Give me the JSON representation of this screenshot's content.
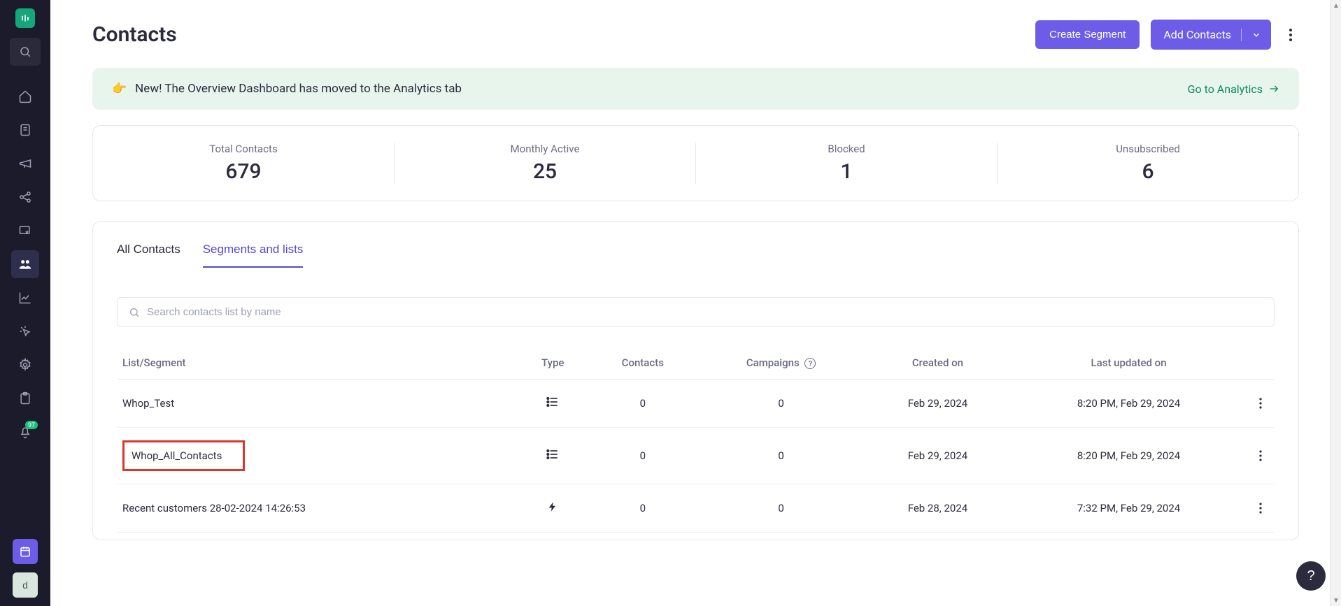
{
  "sidebar": {
    "notification_badge": "97",
    "user_initial": "d"
  },
  "header": {
    "title": "Contacts",
    "create_segment_label": "Create Segment",
    "add_contacts_label": "Add Contacts"
  },
  "banner": {
    "emoji": "👉",
    "text": "New! The Overview Dashboard has moved to the Analytics tab",
    "link_label": "Go to Analytics"
  },
  "stats": [
    {
      "label": "Total Contacts",
      "value": "679"
    },
    {
      "label": "Monthly Active",
      "value": "25"
    },
    {
      "label": "Blocked",
      "value": "1"
    },
    {
      "label": "Unsubscribed",
      "value": "6"
    }
  ],
  "tabs": {
    "all_contacts": "All Contacts",
    "segments_lists": "Segments and lists"
  },
  "search": {
    "placeholder": "Search contacts list by name"
  },
  "table": {
    "columns": {
      "list_segment": "List/Segment",
      "type": "Type",
      "contacts": "Contacts",
      "campaigns": "Campaigns",
      "created_on": "Created on",
      "last_updated_on": "Last updated on"
    },
    "rows": [
      {
        "name": "Whop_Test",
        "type_icon": "list",
        "contacts": "0",
        "campaigns": "0",
        "created_on": "Feb 29, 2024",
        "last_updated_on": "8:20 PM, Feb 29, 2024",
        "highlight": false
      },
      {
        "name": "Whop_All_Contacts",
        "type_icon": "list",
        "contacts": "0",
        "campaigns": "0",
        "created_on": "Feb 29, 2024",
        "last_updated_on": "8:20 PM, Feb 29, 2024",
        "highlight": true
      },
      {
        "name": "Recent customers 28-02-2024 14:26:53",
        "type_icon": "bolt",
        "contacts": "0",
        "campaigns": "0",
        "created_on": "Feb 28, 2024",
        "last_updated_on": "7:32 PM, Feb 29, 2024",
        "highlight": false
      }
    ]
  },
  "help_fab": "?"
}
